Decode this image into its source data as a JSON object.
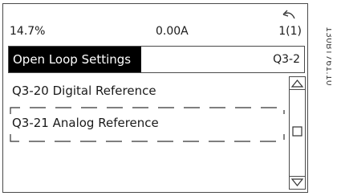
{
  "status": {
    "left": "14.7%",
    "center": "0.00A",
    "right": "1(1)"
  },
  "title": {
    "label": "Open Loop Settings",
    "code": "Q3-2"
  },
  "menu": {
    "items": [
      {
        "label": "Q3-20 Digital Reference"
      },
      {
        "label": "Q3-21 Analog Reference"
      }
    ],
    "selected_index": 1
  },
  "icons": {
    "back": "back-arrow-icon",
    "up": "scroll-up-arrow-icon",
    "down": "scroll-down-arrow-icon"
  },
  "figure_id": "130BT761.10"
}
